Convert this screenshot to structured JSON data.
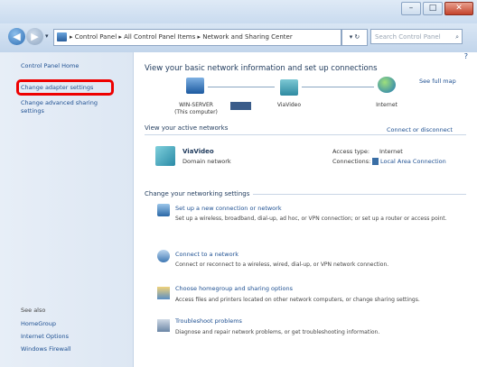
{
  "window": {
    "min": "–",
    "max": "□",
    "close": "✕"
  },
  "address_bar": {
    "back": "◀",
    "forward": "▶",
    "dropdown": "▾",
    "path": "▸ Control Panel ▸ All Control Panel Items ▸ Network and Sharing Center",
    "go": "▾ ↻",
    "search_placeholder": "Search Control Panel",
    "search_icon": "⌕"
  },
  "sidebar": {
    "title": "Control Panel Home",
    "items": [
      {
        "label": "Change adapter settings"
      },
      {
        "label": "Change advanced sharing"
      },
      {
        "label": "settings"
      }
    ],
    "see_also_title": "See also",
    "see_also": [
      "HomeGroup",
      "Internet Options",
      "Windows Firewall"
    ]
  },
  "main": {
    "help": "?",
    "heading": "View your basic network information and set up connections",
    "see_full_map": "See full map",
    "map": {
      "computer_label": [
        "WIN-SERVER",
        "(This computer)"
      ],
      "network_label": "ViaVideo",
      "internet_label": "Internet"
    },
    "active_title": "View your active networks",
    "connect": "Connect or disconnect",
    "network": {
      "name": "ViaVideo",
      "type": "Domain network",
      "access_type_label": "Access type:",
      "access_type_value": "Internet",
      "connections_label": "Connections:",
      "connections_value": "Local Area Connection"
    },
    "change_title": "Change your networking settings",
    "tasks": [
      {
        "label": "Set up a new connection or network",
        "desc": "Set up a wireless, broadband, dial-up, ad hoc, or VPN connection; or set up a router or access point."
      },
      {
        "label": "Connect to a network",
        "desc": "Connect or reconnect to a wireless, wired, dial-up, or VPN network connection."
      },
      {
        "label": "Choose homegroup and sharing options",
        "desc": "Access files and printers located on other network computers, or change sharing settings."
      },
      {
        "label": "Troubleshoot problems",
        "desc": "Diagnose and repair network problems, or get troubleshooting information."
      }
    ]
  }
}
